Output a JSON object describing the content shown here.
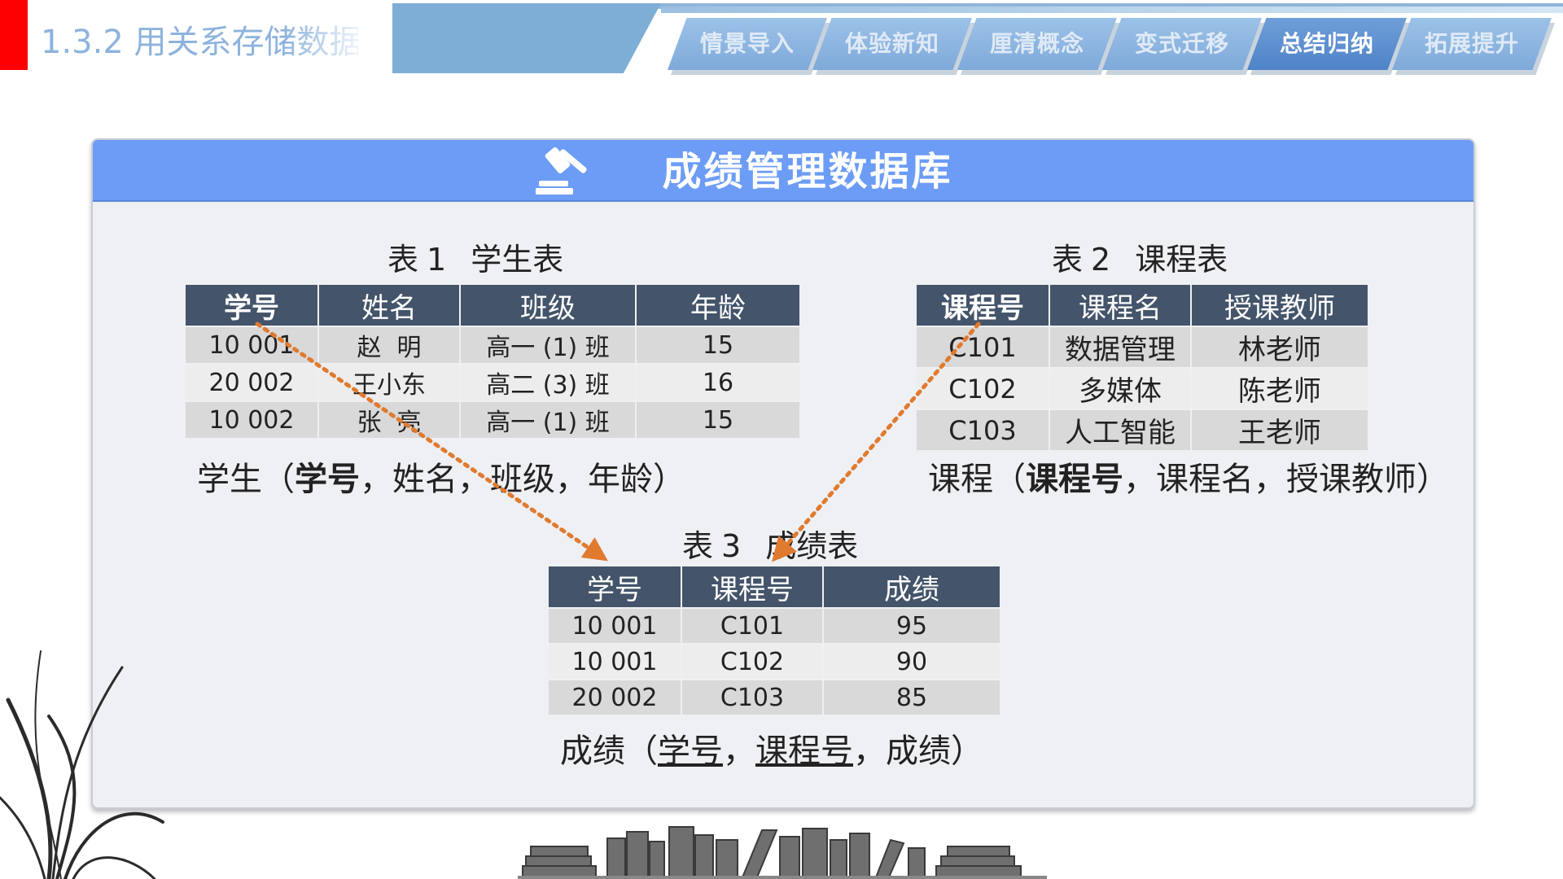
{
  "header": {
    "lesson_title": "1.3.2 用关系存储数据",
    "nav_tabs": [
      {
        "label": "情景导入",
        "active": false
      },
      {
        "label": "体验新知",
        "active": false
      },
      {
        "label": "厘清概念",
        "active": false
      },
      {
        "label": "变式迁移",
        "active": false
      },
      {
        "label": "总结归纳",
        "active": true
      },
      {
        "label": "拓展提升",
        "active": false
      }
    ]
  },
  "card": {
    "title": "成绩管理数据库",
    "icon": "gavel-icon"
  },
  "table1": {
    "caption_label": "表",
    "caption_num": "1",
    "caption_name": "学生表",
    "headers": [
      "学号",
      "姓名",
      "班级",
      "年龄"
    ],
    "rows": [
      [
        "10 001",
        "赵  明",
        "高一 (1) 班",
        "15"
      ],
      [
        "20 002",
        "王小东",
        "高二 (3) 班",
        "16"
      ],
      [
        "10 002",
        "张  亮",
        "高一 (1) 班",
        "15"
      ]
    ],
    "schema": {
      "relation": "学生",
      "open": "（",
      "key": "学号",
      "rest": "，姓名，班级，年龄",
      "close": "）",
      "sep": "，"
    }
  },
  "table2": {
    "caption_label": "表",
    "caption_num": "2",
    "caption_name": "课程表",
    "headers": [
      "课程号",
      "课程名",
      "授课教师"
    ],
    "rows": [
      [
        "C101",
        "数据管理",
        "林老师"
      ],
      [
        "C102",
        "多媒体",
        "陈老师"
      ],
      [
        "C103",
        "人工智能",
        "王老师"
      ]
    ],
    "schema": {
      "relation": "课程",
      "open": "（",
      "key": "课程号",
      "rest": "，课程名，授课教师",
      "close": "）",
      "sep": "，"
    }
  },
  "table3": {
    "caption_label": "表",
    "caption_num": "3",
    "caption_name": "成绩表",
    "headers": [
      "学号",
      "课程号",
      "成绩"
    ],
    "rows": [
      [
        "10 001",
        "C101",
        "95"
      ],
      [
        "10 001",
        "C102",
        "90"
      ],
      [
        "20 002",
        "C103",
        "85"
      ]
    ],
    "schema": {
      "relation": "成绩",
      "open": "（",
      "key1": "学号",
      "sep": "，",
      "key2": "课程号",
      "rest": "成绩",
      "close": "）"
    }
  },
  "colors": {
    "accent_red": "#ff0000",
    "header_blue": "#6c9cf5",
    "table_header": "#44546a",
    "arrow_orange": "#e07a2e",
    "nav_active": "#4f83c8"
  }
}
